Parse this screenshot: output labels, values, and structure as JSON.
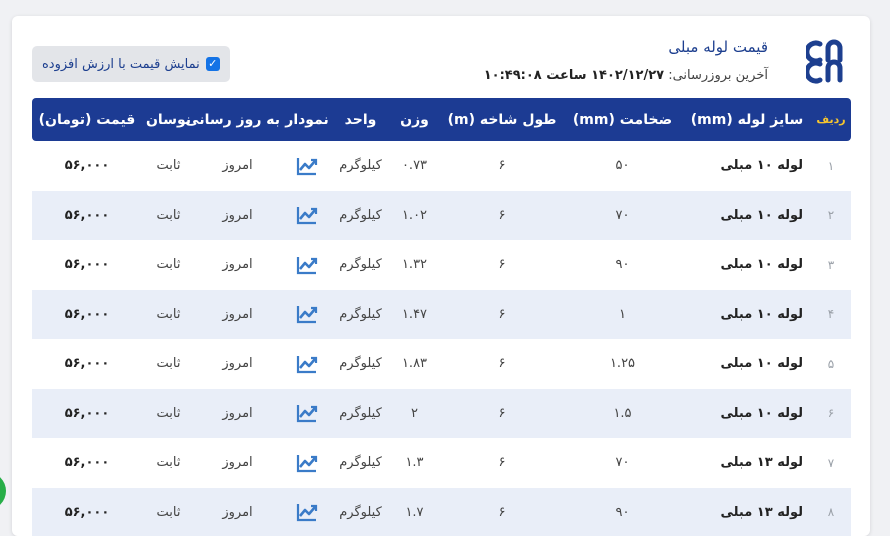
{
  "header": {
    "title": "قیمت لوله مبلی",
    "updated_label": "آخرین بروزرسانی:",
    "updated_value": "۱۴۰۲/۱۲/۲۷ ساعت ۱۰:۴۹:۰۸",
    "vat_toggle_label": "نمایش قیمت با ارزش افزوده",
    "vat_checked": true
  },
  "table": {
    "columns": {
      "row": "ردیف",
      "size": "سایز لوله (mm)",
      "thickness": "ضخامت (mm)",
      "length": "طول شاخه (m)",
      "weight": "وزن",
      "unit": "واحد",
      "chart": "نمودار",
      "updated": "به روز رسانی",
      "change": "نوسان",
      "price": "قیمت (تومان)"
    },
    "rows": [
      {
        "n": "۱",
        "size": "لوله ۱۰ مبلی",
        "thickness": "۵۰",
        "length": "۶",
        "weight": "۰.۷۳",
        "unit": "کیلوگرم",
        "updated": "امروز",
        "change": "ثابت",
        "price": "۵۶,۰۰۰"
      },
      {
        "n": "۲",
        "size": "لوله ۱۰ مبلی",
        "thickness": "۷۰",
        "length": "۶",
        "weight": "۱.۰۲",
        "unit": "کیلوگرم",
        "updated": "امروز",
        "change": "ثابت",
        "price": "۵۶,۰۰۰"
      },
      {
        "n": "۳",
        "size": "لوله ۱۰ مبلی",
        "thickness": "۹۰",
        "length": "۶",
        "weight": "۱.۳۲",
        "unit": "کیلوگرم",
        "updated": "امروز",
        "change": "ثابت",
        "price": "۵۶,۰۰۰"
      },
      {
        "n": "۴",
        "size": "لوله ۱۰ مبلی",
        "thickness": "۱",
        "length": "۶",
        "weight": "۱.۴۷",
        "unit": "کیلوگرم",
        "updated": "امروز",
        "change": "ثابت",
        "price": "۵۶,۰۰۰"
      },
      {
        "n": "۵",
        "size": "لوله ۱۰ مبلی",
        "thickness": "۱.۲۵",
        "length": "۶",
        "weight": "۱.۸۳",
        "unit": "کیلوگرم",
        "updated": "امروز",
        "change": "ثابت",
        "price": "۵۶,۰۰۰"
      },
      {
        "n": "۶",
        "size": "لوله ۱۰ مبلی",
        "thickness": "۱.۵",
        "length": "۶",
        "weight": "۲",
        "unit": "کیلوگرم",
        "updated": "امروز",
        "change": "ثابت",
        "price": "۵۶,۰۰۰"
      },
      {
        "n": "۷",
        "size": "لوله ۱۳ مبلی",
        "thickness": "۷۰",
        "length": "۶",
        "weight": "۱.۳",
        "unit": "کیلوگرم",
        "updated": "امروز",
        "change": "ثابت",
        "price": "۵۶,۰۰۰"
      },
      {
        "n": "۸",
        "size": "لوله ۱۳ مبلی",
        "thickness": "۹۰",
        "length": "۶",
        "weight": "۱.۷",
        "unit": "کیلوگرم",
        "updated": "امروز",
        "change": "ثابت",
        "price": "۵۶,۰۰۰"
      }
    ]
  },
  "colors": {
    "header_bg": "#1c3b93",
    "accent_blue": "#1d3f8f",
    "row_stripe": "#e9eef8",
    "chart_icon": "#3a7bc8",
    "row_label_yellow": "#f4c430"
  },
  "icons": {
    "logo": "brand-logo-icon",
    "chart": "trend-chart-icon",
    "check": "check-icon",
    "chat": "chat-bubble-icon"
  }
}
